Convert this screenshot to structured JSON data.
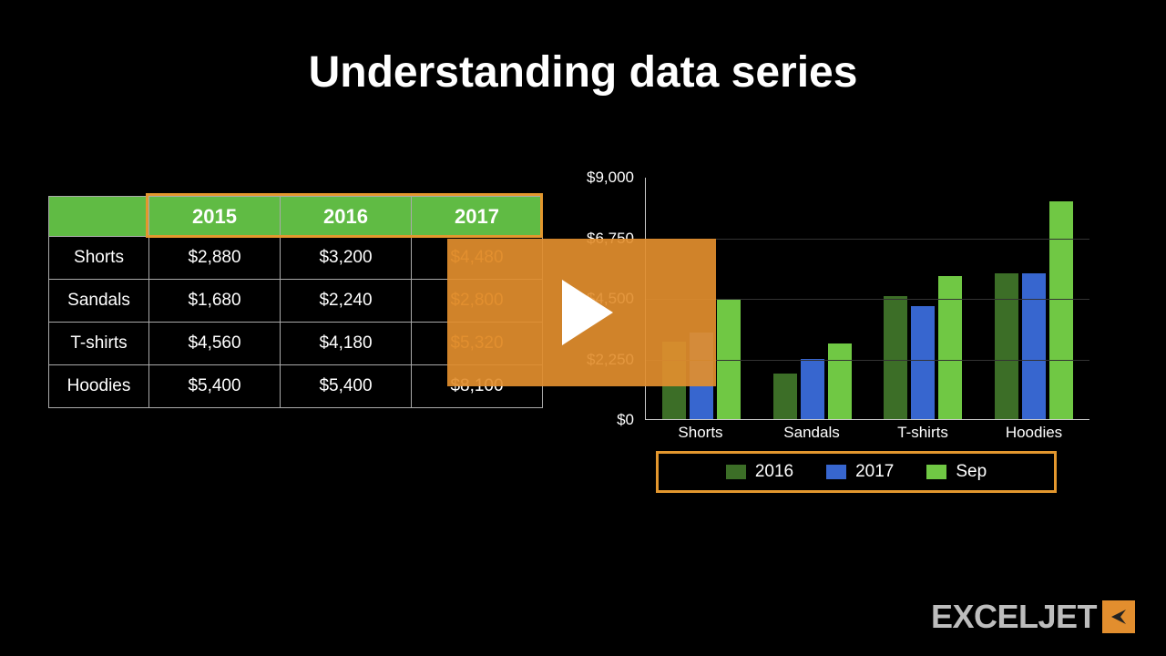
{
  "title": "Understanding data series",
  "table": {
    "headers": [
      "",
      "2015",
      "2016",
      "2017"
    ],
    "rows": [
      {
        "label": "Shorts",
        "cells": [
          "$2,880",
          "$3,200",
          "$4,480"
        ]
      },
      {
        "label": "Sandals",
        "cells": [
          "$1,680",
          "$2,240",
          "$2,800"
        ]
      },
      {
        "label": "T-shirts",
        "cells": [
          "$4,560",
          "$4,180",
          "$5,320"
        ]
      },
      {
        "label": "Hoodies",
        "cells": [
          "$5,400",
          "$5,400",
          "$8,100"
        ]
      }
    ]
  },
  "chart_data": {
    "type": "bar",
    "categories": [
      "Shorts",
      "Sandals",
      "T-shirts",
      "Hoodies"
    ],
    "series": [
      {
        "name": "2016",
        "values": [
          2880,
          1680,
          4560,
          5400
        ],
        "color": "#3c6e27"
      },
      {
        "name": "2017",
        "values": [
          3200,
          2240,
          4180,
          5400
        ],
        "color": "#3766cf"
      },
      {
        "name": "Sep",
        "values": [
          4480,
          2800,
          5320,
          8100
        ],
        "color": "#70c844"
      }
    ],
    "ylim": [
      0,
      9000
    ],
    "yticks": [
      0,
      2250,
      4500,
      6750,
      9000
    ],
    "ytick_labels": [
      "$0",
      "$2,250",
      "$4,500",
      "$6,750",
      "$9,000"
    ],
    "title": "",
    "xlabel": "",
    "ylabel": ""
  },
  "legend": [
    {
      "label": "2016",
      "color": "#3c6e27"
    },
    {
      "label": "2017",
      "color": "#3766cf"
    },
    {
      "label": "Sep",
      "color": "#70c844"
    }
  ],
  "logo": {
    "text": "EXCELJET"
  }
}
